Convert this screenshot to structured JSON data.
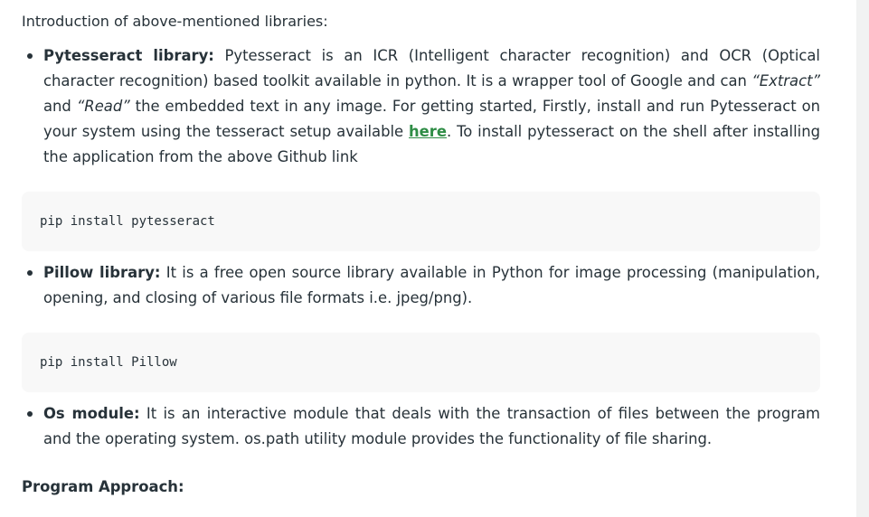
{
  "intro": "Introduction of above-mentioned libraries:",
  "libraries": [
    {
      "name": "Pytesseract library:",
      "text_1": "Pytesseract is an ICR (Intelligent character recognition) and OCR (Optical character recognition) based toolkit available in python. It is a wrapper tool of Google and can ",
      "italic_1": "“Extract”",
      "text_2": " and ",
      "italic_2": "“Read”",
      "text_3": " the embedded text in any image. For getting started, Firstly, install and run Pytesseract on your system using the tesseract setup available ",
      "link": "here",
      "text_4": ". To install pytesseract on the shell after installing the application from the above Github link"
    },
    {
      "name": "Pillow library:",
      "text": "It is a free open source library available in Python for image processing (manipulation, opening, and closing of various file formats i.e. jpeg/png)."
    },
    {
      "name": "Os module:",
      "text": "It is an interactive module that deals with the transaction of files between the program and the operating system. os.path utility module provides the functionality of file sharing."
    }
  ],
  "code_blocks": [
    "pip install pytesseract",
    "pip install Pillow"
  ],
  "heading": "Program Approach:",
  "colors": {
    "text": "#273239",
    "link": "#2f8d46",
    "code_bg": "#f8f8f8"
  }
}
